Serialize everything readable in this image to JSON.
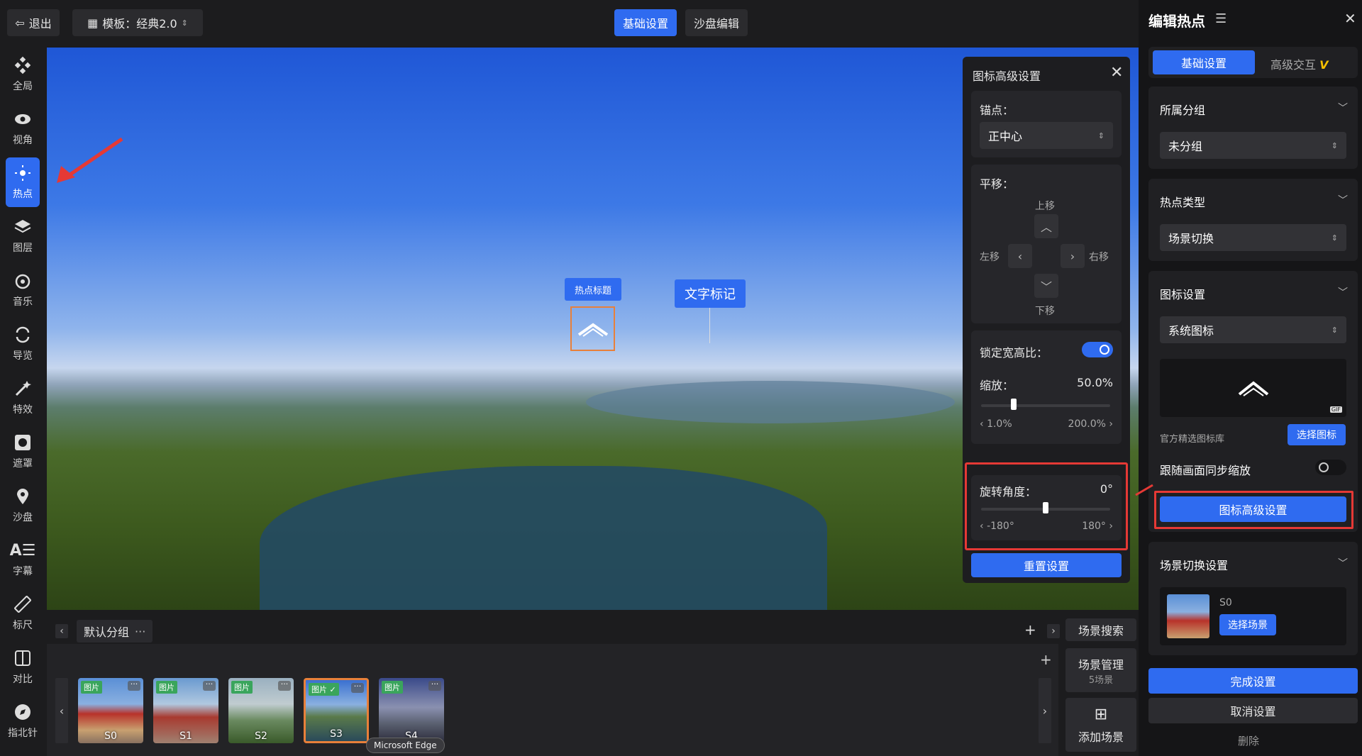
{
  "topbar": {
    "exit": "退出",
    "template": "模板：经典2.0",
    "tab_basic": "基础设置",
    "tab_sandbox": "沙盘编辑"
  },
  "rail": [
    {
      "label": "全局",
      "icon": "apps-icon"
    },
    {
      "label": "视角",
      "icon": "eye-icon"
    },
    {
      "label": "热点",
      "icon": "hotspot-icon"
    },
    {
      "label": "图层",
      "icon": "layers-icon"
    },
    {
      "label": "音乐",
      "icon": "music-icon"
    },
    {
      "label": "导览",
      "icon": "tour-icon"
    },
    {
      "label": "特效",
      "icon": "magic-icon"
    },
    {
      "label": "遮罩",
      "icon": "mask-icon"
    },
    {
      "label": "沙盘",
      "icon": "pin-icon"
    },
    {
      "label": "字幕",
      "icon": "subtitle-icon"
    },
    {
      "label": "标尺",
      "icon": "ruler-icon"
    },
    {
      "label": "对比",
      "icon": "compare-icon"
    },
    {
      "label": "指北针",
      "icon": "compass-icon"
    }
  ],
  "viewer": {
    "hotspot_title": "热点标题",
    "text_marker": "文字标记"
  },
  "advanced": {
    "title": "图标高级设置",
    "anchor_label": "锚点：",
    "anchor_value": "正中心",
    "move_label": "平移：",
    "up": "上移",
    "down": "下移",
    "left": "左移",
    "right": "右移",
    "lock_ratio": "锁定宽高比：",
    "lock_on": true,
    "scale_label": "缩放：",
    "scale_value": "50.0%",
    "scale_min": "1.0%",
    "scale_max": "200.0%",
    "scale_pos": 0.25,
    "rotate_label": "旋转角度：",
    "rotate_value": "0°",
    "rotate_min": "-180°",
    "rotate_max": "180°",
    "rotate_pos": 0.5,
    "reset": "重置设置"
  },
  "right": {
    "title": "编辑热点",
    "tab_basic": "基础设置",
    "tab_adv": "高级交互",
    "group_title": "所属分组",
    "group_value": "未分组",
    "type_title": "热点类型",
    "type_value": "场景切换",
    "icon_title": "图标设置",
    "icon_value": "系统图标",
    "gif_badge": "GIF",
    "library": "官方精选图标库",
    "choose_icon": "选择图标",
    "follow_zoom": "跟随画面同步缩放",
    "adv_btn": "图标高级设置",
    "switch_title": "场景切换设置",
    "scene_name": "S0",
    "choose_scene": "选择场景",
    "done": "完成设置",
    "cancel": "取消设置",
    "delete": "删除"
  },
  "bottom": {
    "group": "默认分组",
    "scene_search": "场景搜索",
    "scene_manage": "场景管理",
    "scene_count": "5场景",
    "add_scene": "添加场景",
    "tooltip": "Microsoft Edge",
    "scenes": [
      {
        "tag": "图片",
        "name": "S0"
      },
      {
        "tag": "图片",
        "name": "S1"
      },
      {
        "tag": "图片",
        "name": "S2"
      },
      {
        "tag": "图片 ✓",
        "name": "S3"
      },
      {
        "tag": "图片",
        "name": "S4"
      }
    ]
  },
  "colors": {
    "accent": "#2f6bf0",
    "highlight": "#e53935"
  }
}
